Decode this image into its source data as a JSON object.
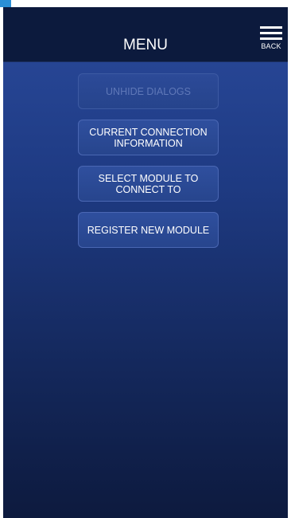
{
  "header": {
    "title": "MENU",
    "back_label": "BACK",
    "back_icon": "hamburger-icon"
  },
  "menu": {
    "items": [
      {
        "label": "UNHIDE DIALOGS",
        "enabled": false
      },
      {
        "label": "CURRENT CONNECTION\nINFORMATION",
        "enabled": true
      },
      {
        "label": "SELECT MODULE TO\nCONNECT TO",
        "enabled": true
      },
      {
        "label": "REGISTER NEW MODULE",
        "enabled": true
      }
    ]
  },
  "colors": {
    "header_bg": "#0c1a3d",
    "background_top": "#2a4a9c",
    "background_bottom": "#0d1a3e",
    "button_border": "#4a67b3",
    "disabled_text": "#5f78b8",
    "corner_tag": "#2a8fd6"
  }
}
